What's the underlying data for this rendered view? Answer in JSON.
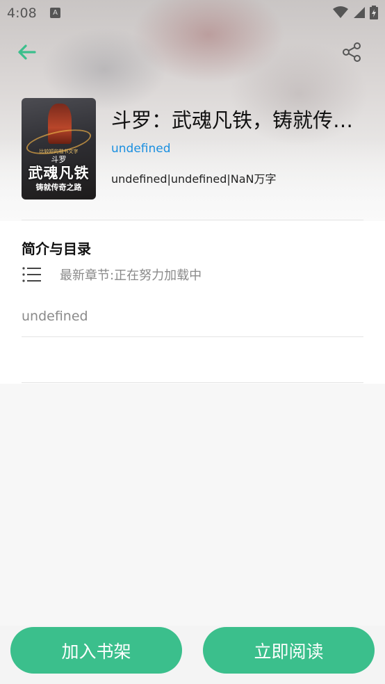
{
  "status_bar": {
    "time": "4:08",
    "notification_letter": "A",
    "icons": [
      "wifi-icon",
      "signal-icon",
      "battery-icon"
    ]
  },
  "header": {
    "back_icon": "arrow-left-icon",
    "share_icon": "share-icon",
    "accent_color": "#3bbf8c"
  },
  "book": {
    "title": "斗罗：武魂凡铁，铸就传奇之路",
    "author": "undefined",
    "meta": "undefined|undefined|NaN万字",
    "cover": {
      "tagline": "比较短的楷书文字",
      "series": "斗罗",
      "main_title": "武魂凡铁",
      "subtitle": "铸就传奇之路"
    }
  },
  "intro": {
    "section_title": "简介与目录",
    "latest_chapter": "最新章节:正在努力加载中",
    "description": "undefined"
  },
  "actions": {
    "add_to_shelf": "加入书架",
    "read_now": "立即阅读"
  }
}
